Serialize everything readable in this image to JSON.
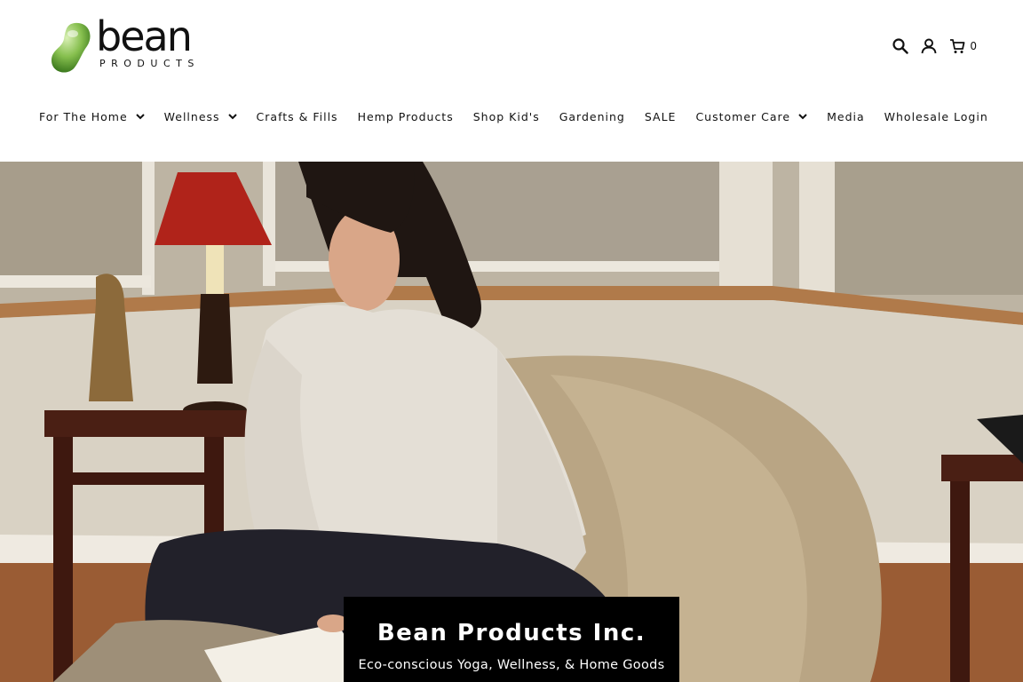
{
  "brand": {
    "logo_word": "bean",
    "logo_sub": "PRODUCTS",
    "logo_green": "#7fb84a"
  },
  "header": {
    "icons": [
      "search-icon",
      "account-icon",
      "cart-icon"
    ],
    "cart_count": "0"
  },
  "nav": {
    "items": [
      {
        "label": "For The Home",
        "dropdown": true
      },
      {
        "label": "Wellness",
        "dropdown": true
      },
      {
        "label": "Crafts & Fills",
        "dropdown": false
      },
      {
        "label": "Hemp Products",
        "dropdown": false
      },
      {
        "label": "Shop Kid's",
        "dropdown": false
      },
      {
        "label": "Gardening",
        "dropdown": false
      },
      {
        "label": "SALE",
        "dropdown": false
      },
      {
        "label": "Customer Care",
        "dropdown": true
      },
      {
        "label": "Media",
        "dropdown": false
      },
      {
        "label": "Wholesale Login",
        "dropdown": false
      }
    ]
  },
  "hero": {
    "title": "Bean Products Inc.",
    "subtitle": "Eco-conscious Yoga, Wellness, & Home Goods"
  },
  "colors": {
    "text": "#111111",
    "caption_bg": "#000000",
    "lamp_shade": "#b0231a",
    "furniture": "#4a1f14",
    "beanbag": "#b9a584"
  }
}
